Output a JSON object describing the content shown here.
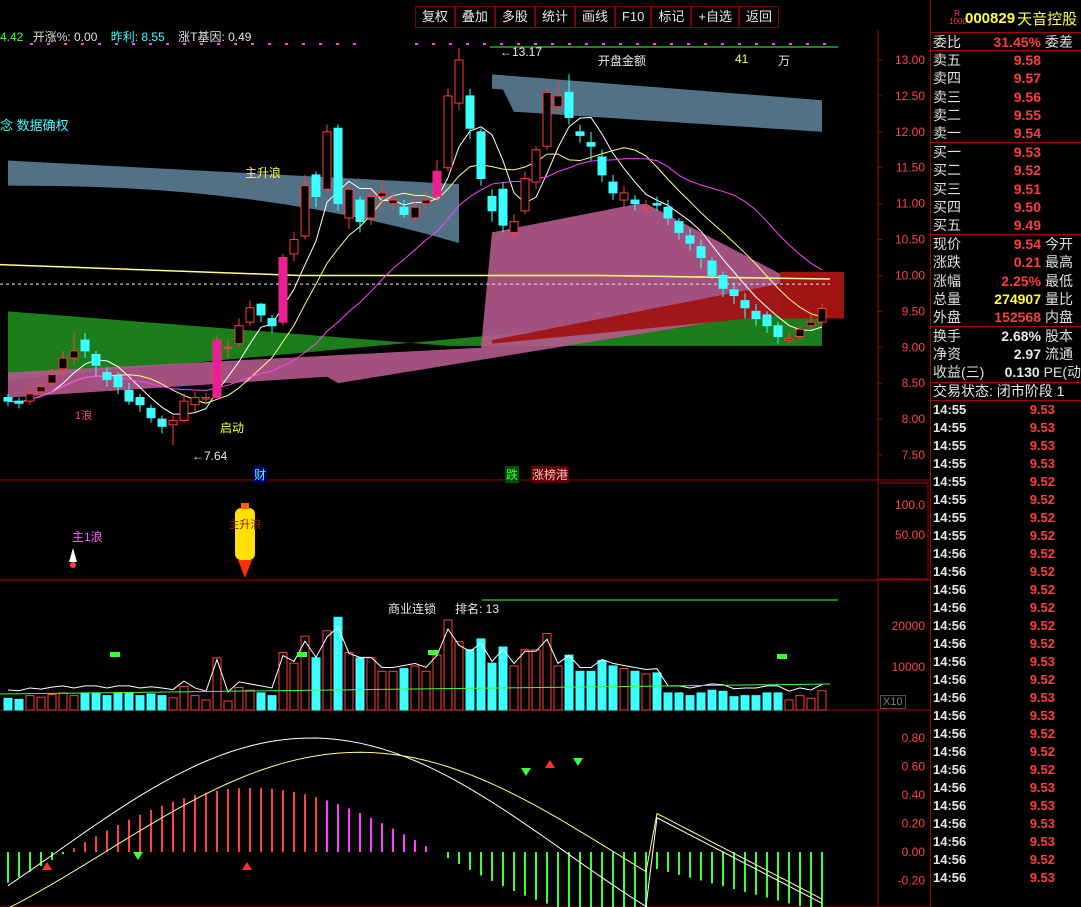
{
  "toolbar": [
    "复权",
    "叠加",
    "多股",
    "统计",
    "画线",
    "F10",
    "标记",
    "+自选",
    "返回"
  ],
  "indicator_line": {
    "part1": "4.42",
    "part2": "开涨%: 0.00",
    "part3": "昨利: 8.55",
    "part4": "涨T基因: 0.49"
  },
  "main_pane": {
    "concept_text": "念 数据确权",
    "label_main_rise": "主升浪",
    "label_wave1": "1浪",
    "label_start": "启动",
    "label_high": "13.17",
    "label_low": "7.64",
    "label_open_amount": "开盘金额",
    "open_amount_value": "41",
    "open_amount_unit": "万",
    "marker_cai": "财",
    "marker_die": "跌",
    "marker_zhangbang": "涨榜港",
    "y_ticks": [
      "13.00",
      "12.50",
      "12.00",
      "11.50",
      "11.00",
      "10.50",
      "10.00",
      "9.50",
      "9.00",
      "8.50",
      "8.00",
      "7.50"
    ]
  },
  "sub_pane1": {
    "label_wave": "主1浪",
    "rocket_text": "主升浪",
    "y_ticks": [
      "100.0",
      "50.00"
    ]
  },
  "volume_pane": {
    "label_name": "商业连锁",
    "label_rank": "排名: ",
    "rank_value": "13",
    "label_x10": "X10",
    "y_ticks": [
      "20000",
      "10000"
    ]
  },
  "macd_pane": {
    "y_ticks": [
      "0.80",
      "0.60",
      "0.40",
      "0.20",
      "0.00",
      "-0.20"
    ]
  },
  "right_panel": {
    "code_badge_top": "R",
    "code_badge_bottom": "1000",
    "code": "000829",
    "name": "天音控股",
    "weibi_label": "委比",
    "weibi_value": "31.45%",
    "weicha_label": "委差",
    "sells": [
      {
        "label": "卖五",
        "price": "9.58"
      },
      {
        "label": "卖四",
        "price": "9.57"
      },
      {
        "label": "卖三",
        "price": "9.56"
      },
      {
        "label": "卖二",
        "price": "9.55"
      },
      {
        "label": "卖一",
        "price": "9.54"
      }
    ],
    "buys": [
      {
        "label": "买一",
        "price": "9.53"
      },
      {
        "label": "买二",
        "price": "9.52"
      },
      {
        "label": "买三",
        "price": "9.51"
      },
      {
        "label": "买四",
        "price": "9.50"
      },
      {
        "label": "买五",
        "price": "9.49"
      }
    ],
    "quotes": [
      {
        "label": "现价",
        "value": "9.54",
        "ext": "今开",
        "color": "red"
      },
      {
        "label": "涨跌",
        "value": "0.21",
        "ext": "最高",
        "color": "red"
      },
      {
        "label": "涨幅",
        "value": "2.25%",
        "ext": "最低",
        "color": "red"
      },
      {
        "label": "总量",
        "value": "274907",
        "ext": "量比",
        "color": "yel"
      },
      {
        "label": "外盘",
        "value": "152568",
        "ext": "内盘",
        "color": "red"
      }
    ],
    "stats": [
      {
        "label": "换手",
        "value": "2.68%",
        "ext": "股本"
      },
      {
        "label": "净资",
        "value": "2.97",
        "ext": "流通"
      },
      {
        "label": "收益(三)",
        "value": "0.130",
        "ext": "PE(动"
      }
    ],
    "trade_status": "交易状态: 闭市阶段 1",
    "ticks": [
      {
        "time": "14:55",
        "price": "9.53",
        "color": "red"
      },
      {
        "time": "14:55",
        "price": "9.53",
        "color": "red"
      },
      {
        "time": "14:55",
        "price": "9.53",
        "color": "red"
      },
      {
        "time": "14:55",
        "price": "9.53",
        "color": "red"
      },
      {
        "time": "14:55",
        "price": "9.52",
        "color": "red"
      },
      {
        "time": "14:55",
        "price": "9.52",
        "color": "red"
      },
      {
        "time": "14:55",
        "price": "9.52",
        "color": "red"
      },
      {
        "time": "14:55",
        "price": "9.52",
        "color": "red"
      },
      {
        "time": "14:56",
        "price": "9.52",
        "color": "red"
      },
      {
        "time": "14:56",
        "price": "9.52",
        "color": "red"
      },
      {
        "time": "14:56",
        "price": "9.52",
        "color": "red"
      },
      {
        "time": "14:56",
        "price": "9.52",
        "color": "red"
      },
      {
        "time": "14:56",
        "price": "9.52",
        "color": "red"
      },
      {
        "time": "14:56",
        "price": "9.52",
        "color": "red"
      },
      {
        "time": "14:56",
        "price": "9.53",
        "color": "red"
      },
      {
        "time": "14:56",
        "price": "9.52",
        "color": "red"
      },
      {
        "time": "14:56",
        "price": "9.53",
        "color": "red"
      },
      {
        "time": "14:56",
        "price": "9.53",
        "color": "red"
      },
      {
        "time": "14:56",
        "price": "9.52",
        "color": "red"
      },
      {
        "time": "14:56",
        "price": "9.52",
        "color": "red"
      },
      {
        "time": "14:56",
        "price": "9.52",
        "color": "red"
      },
      {
        "time": "14:56",
        "price": "9.53",
        "color": "red"
      },
      {
        "time": "14:56",
        "price": "9.53",
        "color": "red"
      },
      {
        "time": "14:56",
        "price": "9.53",
        "color": "red"
      },
      {
        "time": "14:56",
        "price": "9.53",
        "color": "red"
      },
      {
        "time": "14:56",
        "price": "9.52",
        "color": "red"
      },
      {
        "time": "14:56",
        "price": "9.53",
        "color": "red"
      }
    ]
  },
  "colors": {
    "up": "#ff3c3c",
    "down": "#3cffff",
    "border": "#a00000",
    "ma_yellow": "#ffff80",
    "ma_magenta": "#ff40ff",
    "cloud_blue": "#5a7d96",
    "cloud_pink": "#b45a8c",
    "cloud_green": "#1e8c1e",
    "cloud_red": "#a01414"
  },
  "candles": [
    [
      8.3,
      8.25,
      8.35,
      8.18
    ],
    [
      8.25,
      8.22,
      8.3,
      8.15
    ],
    [
      8.25,
      8.35,
      8.42,
      8.2
    ],
    [
      8.38,
      8.45,
      8.5,
      8.3
    ],
    [
      8.5,
      8.62,
      8.7,
      8.45
    ],
    [
      8.7,
      8.85,
      8.95,
      8.6
    ],
    [
      8.85,
      8.95,
      9.2,
      8.75
    ],
    [
      9.1,
      8.95,
      9.2,
      8.85
    ],
    [
      8.9,
      8.75,
      8.95,
      8.6
    ],
    [
      8.65,
      8.55,
      8.72,
      8.45
    ],
    [
      8.6,
      8.45,
      8.65,
      8.35
    ],
    [
      8.4,
      8.25,
      8.5,
      8.2
    ],
    [
      8.3,
      8.2,
      8.35,
      8.1
    ],
    [
      8.15,
      8.02,
      8.2,
      7.95
    ],
    [
      8.0,
      7.9,
      8.05,
      7.8
    ],
    [
      7.92,
      7.98,
      8.05,
      7.64
    ],
    [
      7.98,
      8.25,
      8.35,
      7.95
    ],
    [
      8.2,
      8.3,
      8.38,
      8.1
    ],
    [
      8.28,
      8.3,
      8.36,
      8.2
    ],
    [
      8.3,
      9.1,
      9.15,
      8.3
    ],
    [
      9.0,
      9.0,
      9.1,
      8.85
    ],
    [
      9.05,
      9.3,
      9.4,
      9.0
    ],
    [
      9.35,
      9.55,
      9.65,
      9.3
    ],
    [
      9.6,
      9.45,
      9.62,
      9.35
    ],
    [
      9.4,
      9.3,
      9.45,
      9.2
    ],
    [
      9.35,
      10.25,
      10.3,
      9.3
    ],
    [
      10.3,
      10.5,
      10.6,
      10.2
    ],
    [
      10.55,
      11.25,
      11.4,
      10.5
    ],
    [
      11.4,
      11.1,
      11.45,
      10.95
    ],
    [
      11.2,
      12.0,
      12.1,
      11.15
    ],
    [
      12.05,
      11.0,
      12.1,
      10.9
    ],
    [
      10.8,
      11.2,
      11.25,
      10.65
    ],
    [
      11.05,
      10.75,
      11.1,
      10.6
    ],
    [
      10.8,
      11.1,
      11.2,
      10.7
    ],
    [
      11.1,
      11.15,
      11.3,
      10.95
    ],
    [
      11.0,
      11.05,
      11.15,
      10.9
    ],
    [
      10.95,
      10.85,
      11.05,
      10.8
    ],
    [
      10.8,
      10.95,
      11.1,
      10.75
    ],
    [
      11.0,
      11.05,
      11.2,
      10.9
    ],
    [
      11.1,
      11.45,
      11.6,
      11.0
    ],
    [
      11.5,
      12.5,
      12.6,
      11.45
    ],
    [
      12.4,
      13.0,
      13.17,
      12.3
    ],
    [
      12.5,
      12.05,
      12.6,
      11.9
    ],
    [
      12.0,
      11.35,
      12.05,
      11.25
    ],
    [
      11.1,
      10.9,
      11.2,
      10.75
    ],
    [
      11.2,
      10.7,
      11.3,
      10.6
    ],
    [
      10.6,
      10.75,
      10.85,
      10.5
    ],
    [
      10.9,
      11.35,
      11.45,
      10.85
    ],
    [
      11.3,
      11.75,
      11.8,
      11.2
    ],
    [
      11.8,
      12.55,
      12.6,
      11.75
    ],
    [
      12.35,
      12.5,
      12.7,
      12.25
    ],
    [
      12.55,
      12.2,
      12.8,
      12.1
    ],
    [
      12.0,
      11.95,
      12.1,
      11.85
    ],
    [
      11.85,
      11.8,
      12.0,
      11.6
    ],
    [
      11.65,
      11.4,
      11.75,
      11.3
    ],
    [
      11.3,
      11.15,
      11.4,
      11.05
    ],
    [
      11.05,
      11.15,
      11.25,
      10.95
    ],
    [
      11.05,
      11.0,
      11.12,
      10.9
    ],
    [
      10.95,
      10.95,
      11.05,
      10.85
    ],
    [
      11.0,
      10.98,
      11.1,
      10.9
    ],
    [
      10.95,
      10.8,
      11.05,
      10.7
    ],
    [
      10.75,
      10.6,
      10.8,
      10.5
    ],
    [
      10.55,
      10.45,
      10.65,
      10.35
    ],
    [
      10.4,
      10.25,
      10.5,
      10.1
    ],
    [
      10.2,
      10.0,
      10.25,
      9.95
    ],
    [
      10.0,
      9.82,
      10.05,
      9.7
    ],
    [
      9.8,
      9.72,
      9.9,
      9.6
    ],
    [
      9.65,
      9.55,
      9.75,
      9.4
    ],
    [
      9.5,
      9.4,
      9.6,
      9.3
    ],
    [
      9.45,
      9.3,
      9.5,
      9.2
    ],
    [
      9.3,
      9.15,
      9.35,
      9.05
    ],
    [
      9.1,
      9.12,
      9.2,
      9.05
    ],
    [
      9.15,
      9.25,
      9.3,
      9.1
    ],
    [
      9.3,
      9.35,
      9.45,
      9.25
    ],
    [
      9.35,
      9.54,
      9.6,
      9.3
    ]
  ]
}
